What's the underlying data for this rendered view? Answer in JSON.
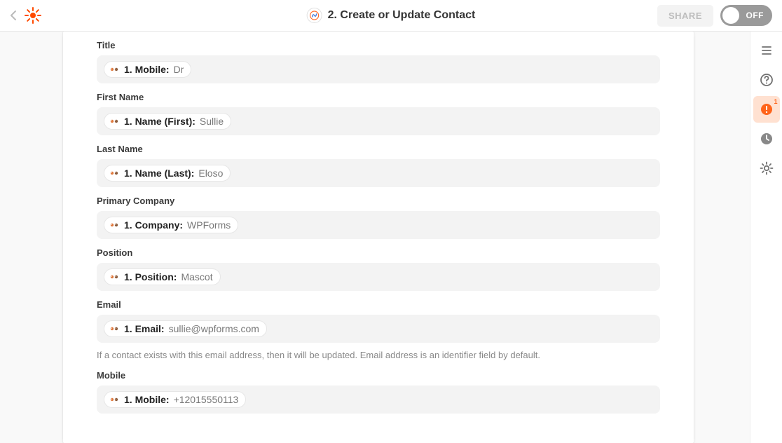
{
  "header": {
    "title": "2. Create or Update Contact",
    "share_label": "SHARE",
    "toggle_label": "OFF"
  },
  "rail": {
    "alert_count": "1"
  },
  "fields": [
    {
      "label": "Title",
      "key": "1. Mobile:",
      "value": "Dr",
      "help": ""
    },
    {
      "label": "First Name",
      "key": "1. Name (First):",
      "value": "Sullie",
      "help": ""
    },
    {
      "label": "Last Name",
      "key": "1. Name (Last):",
      "value": "Eloso",
      "help": ""
    },
    {
      "label": "Primary Company",
      "key": "1. Company:",
      "value": "WPForms",
      "help": ""
    },
    {
      "label": "Position",
      "key": "1. Position:",
      "value": "Mascot",
      "help": ""
    },
    {
      "label": "Email",
      "key": "1. Email:",
      "value": "sullie@wpforms.com",
      "help": "If a contact exists with this email address, then it will be updated. Email address is an identifier field by default."
    },
    {
      "label": "Mobile",
      "key": "1. Mobile:",
      "value": "+12015550113",
      "help": ""
    }
  ]
}
